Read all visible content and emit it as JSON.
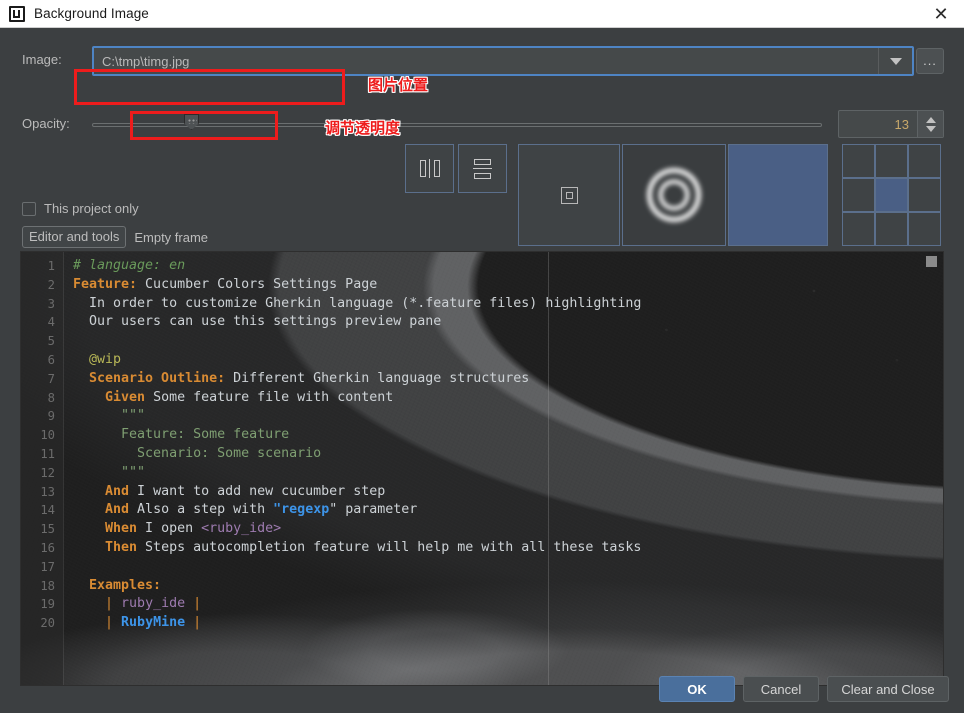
{
  "window": {
    "title": "Background Image",
    "app_icon": "intellij-idea-logo-icon",
    "close_label": "✕"
  },
  "form": {
    "image_label": "Image:",
    "image_value": "C:\\tmp\\timg.jpg",
    "image_placeholder": "C:\\tmp\\timg.jpg",
    "dropdown_icon": "chevron-down-icon",
    "browse_label": "...",
    "opacity_label": "Opacity:",
    "opacity_value": "13",
    "stepper_up_icon": "stepper-up-icon",
    "stepper_down_icon": "stepper-down-icon",
    "this_project_only_label": "This project only",
    "this_project_only_checked": false,
    "tab_editor_and_tools": "Editor and tools",
    "tab_empty_frame": "Empty frame"
  },
  "placement": {
    "mirror_horizontal_icon": "mirror-horizontal-icon",
    "mirror_vertical_icon": "mirror-vertical-icon",
    "fill_none_icon": "fill-none-icon",
    "fill_scale_icon": "fill-scale-icon",
    "fill_tile_icon": "fill-tile-icon",
    "anchor_selected": "center",
    "anchor_cells": [
      "top-left",
      "top-center",
      "top-right",
      "middle-left",
      "middle-center",
      "middle-right",
      "bottom-left",
      "bottom-center",
      "bottom-right"
    ],
    "selected_fill": "tile",
    "accent_border": "#5b6f8c",
    "accent_fill": "#4a5f85"
  },
  "editor": {
    "background_image_description": "earth-from-space-photo",
    "scrollbar_icon": "scrollbar-thumb",
    "lines": [
      {
        "n": "1",
        "segments": [
          {
            "t": "# language: en",
            "c": "k-comment"
          }
        ]
      },
      {
        "n": "2",
        "segments": [
          {
            "t": "Feature:",
            "c": "k-keyword"
          },
          {
            "t": " Cucumber Colors Settings Page",
            "c": "k-text"
          }
        ]
      },
      {
        "n": "3",
        "segments": [
          {
            "t": "  In order to customize Gherkin language (*.feature files) highlighting",
            "c": "k-text"
          }
        ]
      },
      {
        "n": "4",
        "segments": [
          {
            "t": "  Our users can use this settings preview pane",
            "c": "k-text"
          }
        ]
      },
      {
        "n": "5",
        "segments": [
          {
            "t": "",
            "c": "k-text"
          }
        ]
      },
      {
        "n": "6",
        "segments": [
          {
            "t": "  @wip",
            "c": "k-yellow"
          }
        ]
      },
      {
        "n": "7",
        "segments": [
          {
            "t": "  Scenario Outline:",
            "c": "k-keyword"
          },
          {
            "t": " Different Gherkin language structures",
            "c": "k-text"
          }
        ]
      },
      {
        "n": "8",
        "segments": [
          {
            "t": "    Given",
            "c": "k-keyword"
          },
          {
            "t": " Some feature file with content",
            "c": "k-text"
          }
        ]
      },
      {
        "n": "9",
        "segments": [
          {
            "t": "      \"\"\"",
            "c": "k-green"
          }
        ]
      },
      {
        "n": "10",
        "segments": [
          {
            "t": "      Feature: Some feature",
            "c": "k-green"
          }
        ]
      },
      {
        "n": "11",
        "segments": [
          {
            "t": "        Scenario: Some scenario",
            "c": "k-green"
          }
        ]
      },
      {
        "n": "12",
        "segments": [
          {
            "t": "      \"\"\"",
            "c": "k-green"
          }
        ]
      },
      {
        "n": "13",
        "segments": [
          {
            "t": "    And",
            "c": "k-keyword"
          },
          {
            "t": " I want to add new cucumber step",
            "c": "k-text"
          }
        ]
      },
      {
        "n": "14",
        "segments": [
          {
            "t": "    And",
            "c": "k-keyword"
          },
          {
            "t": " Also a step with ",
            "c": "k-text"
          },
          {
            "t": "\"",
            "c": "k-blue"
          },
          {
            "t": "regexp",
            "c": "k-blue"
          },
          {
            "t": "\"",
            "c": "k-text"
          },
          {
            "t": " parameter",
            "c": "k-text"
          }
        ]
      },
      {
        "n": "15",
        "segments": [
          {
            "t": "    When",
            "c": "k-keyword"
          },
          {
            "t": " I open ",
            "c": "k-text"
          },
          {
            "t": "<ruby_ide>",
            "c": "k-purple"
          }
        ]
      },
      {
        "n": "16",
        "segments": [
          {
            "t": "    Then",
            "c": "k-keyword"
          },
          {
            "t": " Steps autocompletion feature will help me with all these tasks",
            "c": "k-text"
          }
        ]
      },
      {
        "n": "17",
        "segments": [
          {
            "t": "",
            "c": "k-text"
          }
        ]
      },
      {
        "n": "18",
        "segments": [
          {
            "t": "  Examples:",
            "c": "k-keyword"
          }
        ]
      },
      {
        "n": "19",
        "segments": [
          {
            "t": "    | ",
            "c": "k-pipe"
          },
          {
            "t": "ruby_ide",
            "c": "k-purple"
          },
          {
            "t": " |",
            "c": "k-pipe"
          }
        ]
      },
      {
        "n": "20",
        "segments": [
          {
            "t": "    | ",
            "c": "k-pipe"
          },
          {
            "t": "RubyMine",
            "c": "k-blue"
          },
          {
            "t": " |",
            "c": "k-pipe"
          }
        ]
      }
    ]
  },
  "footer": {
    "ok_label": "OK",
    "cancel_label": "Cancel",
    "clear_and_close_label": "Clear and Close"
  },
  "annotations": {
    "color": "#ee1c1c",
    "image_location_text": "图片位置",
    "opacity_text": "调节透明度"
  }
}
